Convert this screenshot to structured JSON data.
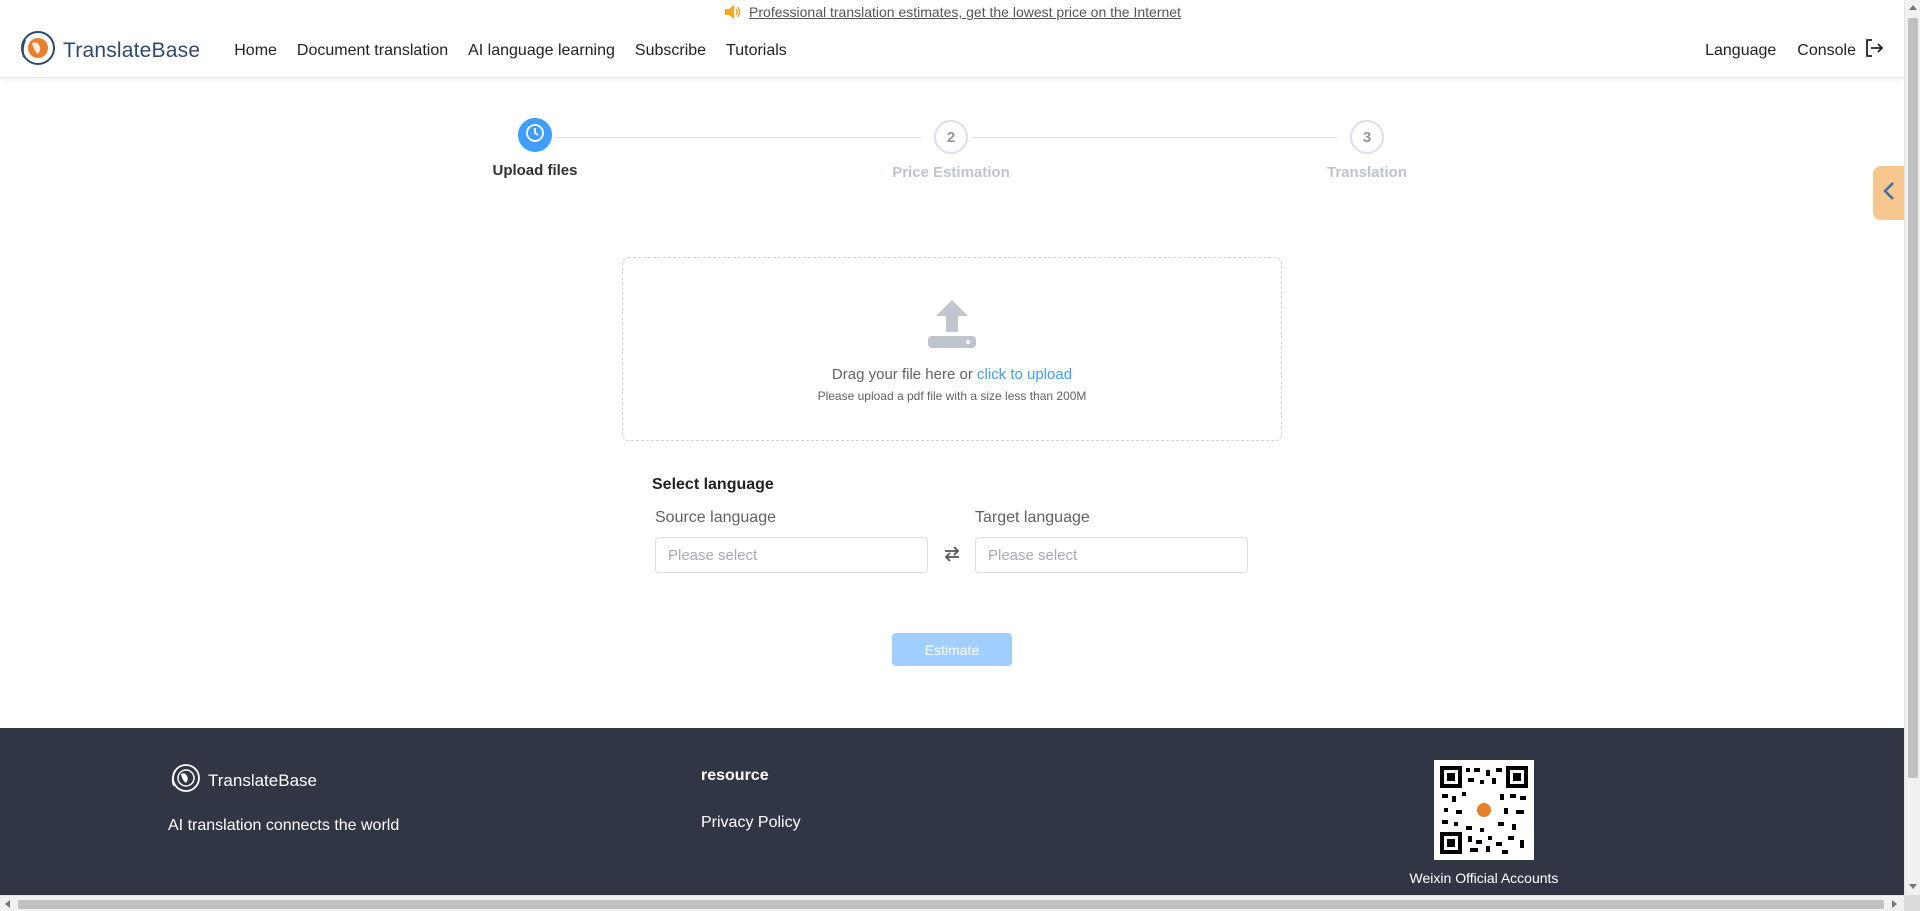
{
  "notice": {
    "text": "Professional translation estimates, get the lowest price on the Internet",
    "icon": "speaker-icon"
  },
  "header": {
    "brand": "TranslateBase",
    "nav": [
      "Home",
      "Document translation",
      "AI language learning",
      "Subscribe",
      "Tutorials"
    ],
    "language": "Language",
    "console": "Console"
  },
  "steps": [
    {
      "number": "",
      "title": "Upload files",
      "active": true
    },
    {
      "number": "2",
      "title": "Price Estimation",
      "active": false
    },
    {
      "number": "3",
      "title": "Translation",
      "active": false
    }
  ],
  "upload": {
    "text_prefix": "Drag your file here or ",
    "text_link": "click to upload",
    "tip": "Please upload a pdf file with a size less than 200M"
  },
  "language_select": {
    "title": "Select language",
    "source_label": "Source language",
    "source_placeholder": "Please select",
    "target_label": "Target language",
    "target_placeholder": "Please select"
  },
  "estimate_button": "Estimate",
  "footer": {
    "brand": "TranslateBase",
    "tagline": "AI translation connects the world",
    "resource_title": "resource",
    "privacy_link": "Privacy Policy",
    "qr_caption": "Weixin Official Accounts"
  },
  "colors": {
    "primary": "#409eff",
    "primary_disabled": "#a0cfff",
    "footer_bg": "#303644",
    "side_toggle": "#f7c58e",
    "brand_text": "#2c4a6e"
  }
}
